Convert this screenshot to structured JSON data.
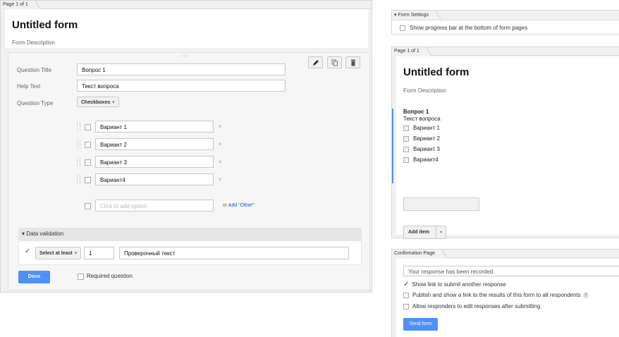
{
  "left_panel": {
    "page_tab": "Page 1 of 1",
    "form_title": "Untitled form",
    "form_description": "Form Description",
    "editor": {
      "question_title_label": "Question Title",
      "question_title_value": "Вопрос 1",
      "help_text_label": "Help Text",
      "help_text_value": "Текст вопроса",
      "question_type_label": "Question Type",
      "question_type_value": "Checkboxes",
      "options": [
        "Вариант 1",
        "Вариант 2",
        "Вариант 3",
        "Вариант4"
      ],
      "remove_glyph": "×",
      "add_option_placeholder": "Click to add option",
      "add_other_prefix": "or",
      "add_other_link": "Add \"Other\"",
      "data_validation_label": "Data validation",
      "validation_rule": "Select at least",
      "validation_count": "1",
      "validation_error_text": "Проверочный текст",
      "done_button": "Done",
      "required_label": "Required question"
    }
  },
  "form_settings": {
    "tab_label": "Form Settings",
    "progress_bar_label": "Show progress bar at the bottom of form pages"
  },
  "preview": {
    "page_tab": "Page 1 of 1",
    "form_title": "Untitled form",
    "form_description": "Form Description",
    "question_title": "Вопрос 1",
    "question_help": "Текст вопроса",
    "options": [
      "Вариант 1",
      "Вариант 2",
      "Вариант 3",
      "Вариант4"
    ],
    "add_item_button": "Add item"
  },
  "confirmation": {
    "tab_label": "Confirmation Page",
    "message_value": "Your response has been recorded.",
    "show_link_label": "Show link to submit another response",
    "publish_label": "Publish and show a link to the results of this form to all respondents",
    "allow_edit_label": "Allow responders to edit responses after submitting",
    "send_button": "Send form"
  },
  "colors": {
    "accent_blue": "#4d90fe",
    "link_blue": "#1155cc"
  }
}
